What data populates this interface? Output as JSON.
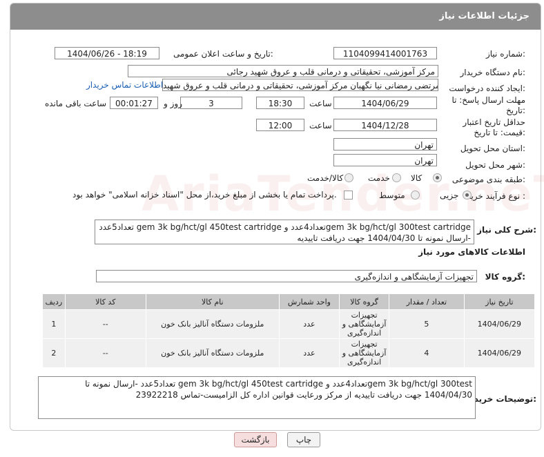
{
  "header": {
    "title": "جزئیات اطلاعات نیاز"
  },
  "fields": {
    "need_number_label": "شماره نیاز:",
    "need_number": "1104099414001763",
    "announce_label": "تاریخ و ساعت اعلان عمومی:",
    "announce_value": "1404/06/26 - 18:19",
    "buyer_org_label": "نام دستگاه خریدار:",
    "buyer_org": "مرکز آموزشی، تحقیقاتی و درمانی قلب و عروق شهید رجائی",
    "requester_label": "ایجاد کننده درخواست:",
    "requester": "مرتضی رمضانی نیا نگهبان مرکز آموزشی، تحقیقاتی و درمانی قلب و عروق شهید",
    "buyer_contact_link": "اطلاعات تماس خریدار",
    "deadline_label": "مهلت ارسال پاسخ: تا تاریخ:",
    "deadline_date": "1404/06/29",
    "time_label": "ساعت",
    "deadline_time": "18:30",
    "days_value": "3",
    "days_label": "روز و",
    "remaining_time": "00:01:27",
    "remaining_label": "ساعت باقی مانده",
    "min_validity_label": "حداقل تاریخ اعتبار قیمت: تا تاریخ:",
    "validity_date": "1404/12/28",
    "validity_time": "12:00",
    "province_label": "استان محل تحویل:",
    "province": "تهران",
    "city_label": "شهر محل تحویل:",
    "city": "تهران",
    "category_label": "طبقه بندی موضوعی:",
    "category_options": [
      "کالا",
      "خدمت",
      "کالا/خدمت"
    ],
    "process_label": "نوع فرآیند خرید :",
    "process_options": [
      "جزیی",
      "متوسط"
    ],
    "payment_note": "پرداخت تمام یا بخشی از مبلغ خرید،از محل \"اسناد خزانه اسلامی\" خواهد بود."
  },
  "description": {
    "label": "شرح کلی نیاز:",
    "text": "gem 3k bg/hct/gl 300test cartridgeتعداد4عدد و gem 3k bg/hct/gl 450test cartridge تعداد5عدد -ارسال نمونه تا 1404/04/30 جهت دریافت تاییدیه"
  },
  "goods": {
    "section_title": "اطلاعات کالاهای مورد نیاز",
    "group_label": "گروه کالا:",
    "group_value": "تجهیزات آزمایشگاهی و اندازه‌گیری",
    "columns": [
      "ردیف",
      "کد کالا",
      "نام کالا",
      "واحد شمارش",
      "گروه کالا",
      "تعداد / مقدار",
      "تاریخ نیاز"
    ],
    "rows": [
      {
        "row": "1",
        "code": "--",
        "name": "ملزومات دستگاه آنالیز بانک خون",
        "unit": "عدد",
        "group": "تجهیزات آزمایشگاهی و اندازه‌گیری",
        "qty": "5",
        "date": "1404/06/29"
      },
      {
        "row": "2",
        "code": "--",
        "name": "ملزومات دستگاه آنالیز بانک خون",
        "unit": "عدد",
        "group": "تجهیزات آزمایشگاهی و اندازه‌گیری",
        "qty": "4",
        "date": "1404/06/29"
      }
    ]
  },
  "buyer_notes": {
    "label": "توضیحات خریدار:",
    "text": "gem 3k bg/hct/gl 300testتعداد4عدد و gem 3k bg/hct/gl 450test cartridge تعداد5عدد -ارسال نمونه تا 1404/04/30 جهت دریافت تاییدیه از مرکز ورعایت قوانین اداره کل الزامیست-تماس 23922218"
  },
  "buttons": {
    "print": "چاپ",
    "back": "بازگشت"
  },
  "watermark": "AriaTender.neT"
}
